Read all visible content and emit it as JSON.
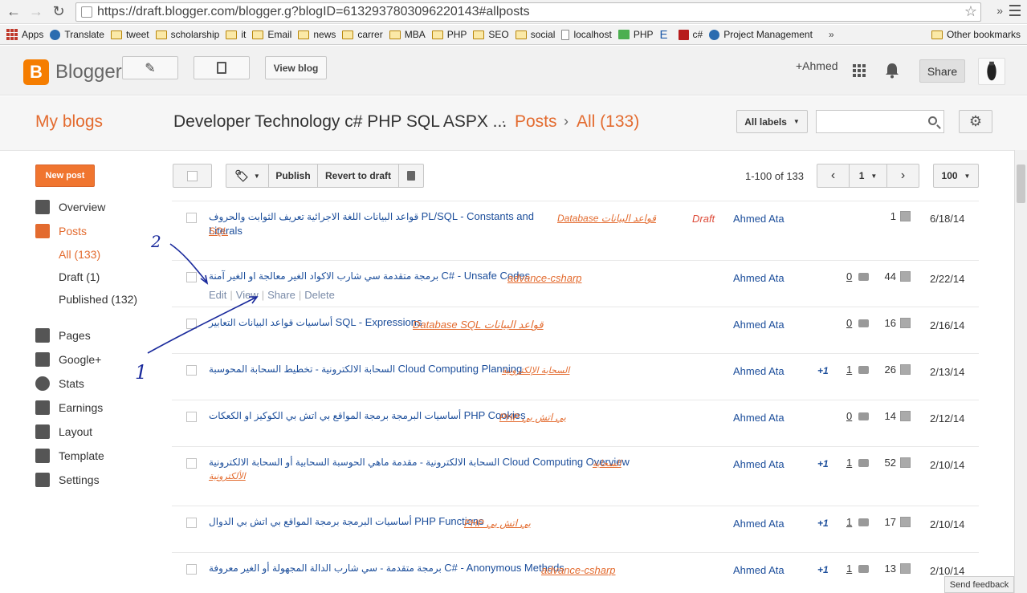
{
  "browser": {
    "url": "https://draft.blogger.com/blogger.g?blogID=6132937803096220143#allposts",
    "chevron_right": "»",
    "bookmarks": [
      "Apps",
      "Translate",
      "tweet",
      "scholarship",
      "it",
      "Email",
      "news",
      "carrer",
      "MBA",
      "PHP",
      "SEO",
      "social",
      "localhost",
      "PHP",
      "E",
      "c#",
      "Project Management"
    ],
    "more": "»",
    "other_bookmarks": "Other bookmarks"
  },
  "header": {
    "logo_text": "Blogger",
    "view_blog": "View blog",
    "user": "+Ahmed",
    "share": "Share"
  },
  "titlebar": {
    "my_blogs": "My blogs",
    "blog_title": "Developer Technology c# PHP SQL ASPX ...",
    "dot": "·",
    "posts": "Posts",
    "arrow": "›",
    "all": "All (133)",
    "all_labels": "All labels"
  },
  "sidebar": {
    "new_post": "New post",
    "items": [
      "Overview",
      "Posts",
      "Pages",
      "Google+",
      "Stats",
      "Earnings",
      "Layout",
      "Template",
      "Settings"
    ],
    "sub": [
      "All (133)",
      "Draft (1)",
      "Published (132)"
    ]
  },
  "toolbar": {
    "publish": "Publish",
    "revert": "Revert to draft",
    "count": "1-100 of 133",
    "page": "1",
    "per_page": "100"
  },
  "posts": [
    {
      "ar": "قواعد البيانات اللغة الاجرائية تعريف الثوابت والحروف",
      "en": "PL/SQL - Constants and Literals",
      "label1": "Database قواعد البيانات",
      "label2": "SQL",
      "status": "Draft",
      "author": "Ahmed Ata",
      "plus": "",
      "comments": "",
      "views": "1",
      "date": "6/18/14"
    },
    {
      "ar": "برمجة متقدمة سي شارب الاكواد الغير معالجة او الغير آمنة",
      "en": "C# - Unsafe Codes",
      "label1": "advance-csharp",
      "label2": "",
      "status": "",
      "author": "Ahmed Ata",
      "plus": "",
      "comments": "0",
      "views": "44",
      "date": "2/22/14",
      "actions": [
        "Edit",
        "View",
        "Share",
        "Delete"
      ]
    },
    {
      "ar": "أساسيات قواعد البيانات التعابير",
      "en": "SQL - Expressions",
      "label1": "Database SQL قواعد البيانات",
      "label2": "",
      "status": "",
      "author": "Ahmed Ata",
      "plus": "",
      "comments": "0",
      "views": "16",
      "date": "2/16/14"
    },
    {
      "ar": "السحابة الالكترونية - تخطيط السحابة المحوسبة",
      "en": "Cloud Computing Planning",
      "label1": "السحابة الإلكترونية",
      "label2": "",
      "status": "",
      "author": "Ahmed Ata",
      "plus": "+1",
      "comments": "1",
      "views": "26",
      "date": "2/13/14"
    },
    {
      "ar": "أساسيات البرمجة برمجة المواقع بي اتش بي الكوكيز او الكعكات",
      "en": "PHP Cookies",
      "label1": "PHP بي اتش بي",
      "label2": "",
      "status": "",
      "author": "Ahmed Ata",
      "plus": "",
      "comments": "0",
      "views": "14",
      "date": "2/12/14"
    },
    {
      "ar": "السحابة الالكترونية - مقدمة ماهي الحوسبة السحابية أو السحابة الالكترونية",
      "en": "Cloud Computing Overview",
      "label1": "السحابة",
      "label2": "الألكترونية",
      "status": "",
      "author": "Ahmed Ata",
      "plus": "+1",
      "comments": "1",
      "views": "52",
      "date": "2/10/14"
    },
    {
      "ar": "أساسيات البرمجة برمجة المواقع بي اتش بي الدوال",
      "en": "PHP Functions",
      "label1": "PHP بي اتش بي",
      "label2": "",
      "status": "",
      "author": "Ahmed Ata",
      "plus": "+1",
      "comments": "1",
      "views": "17",
      "date": "2/10/14"
    },
    {
      "ar": "برمجة متقدمة - سي شارب الدالة المجهولة أو الغير معروفة",
      "en": "C# - Anonymous Methods",
      "label1": "advance-csharp",
      "label2": "",
      "status": "",
      "author": "Ahmed Ata",
      "plus": "+1",
      "comments": "1",
      "views": "13",
      "date": "2/10/14"
    }
  ],
  "annotations": {
    "one": "1",
    "two": "2"
  },
  "feedback": "Send feedback",
  "colors": {
    "accent": "#e36b2f",
    "link": "#1c4e9b",
    "new_post_bg": "#f0752f"
  }
}
